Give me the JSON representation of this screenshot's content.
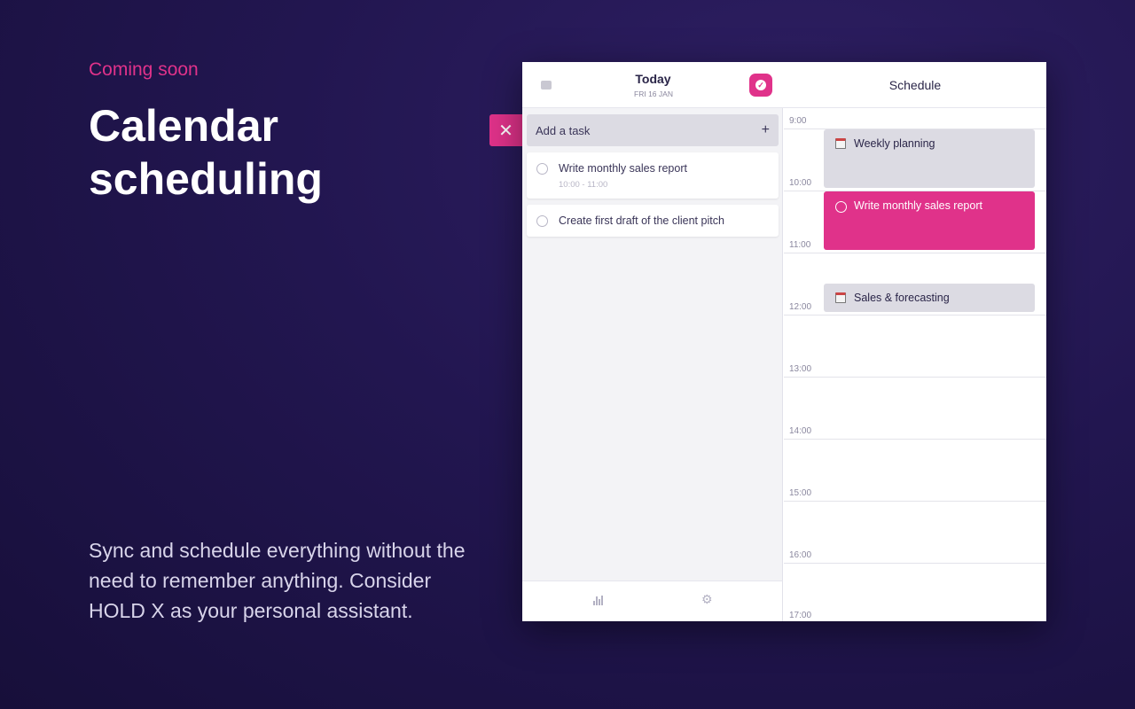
{
  "promo": {
    "eyebrow": "Coming soon",
    "title": "Calendar scheduling",
    "description": "Sync and schedule everything without the need to remember anything. Consider HOLD X as your personal assistant."
  },
  "colors": {
    "accent": "#e0328a",
    "background": "#221650"
  },
  "header": {
    "today_label": "Today",
    "date_label": "FRI 16 JAN",
    "schedule_label": "Schedule",
    "inbox_icon": "inbox-icon",
    "check_icon": "check-circle-icon"
  },
  "tasks": {
    "add_label": "Add a task",
    "items": [
      {
        "title": "Write monthly sales report",
        "time": "10:00 - 11:00"
      },
      {
        "title": "Create first draft of the client pitch"
      }
    ]
  },
  "footer": {
    "icons": [
      "bar-chart-icon",
      "gear-icon"
    ]
  },
  "schedule": {
    "hours": [
      "9:00",
      "10:00",
      "11:00",
      "12:00",
      "13:00",
      "14:00",
      "15:00",
      "16:00",
      "17:00"
    ],
    "events": [
      {
        "title": "Weekly planning",
        "type": "calendar"
      },
      {
        "title": "Write monthly sales report",
        "type": "task"
      },
      {
        "title": "Sales & forecasting",
        "type": "calendar"
      }
    ]
  }
}
